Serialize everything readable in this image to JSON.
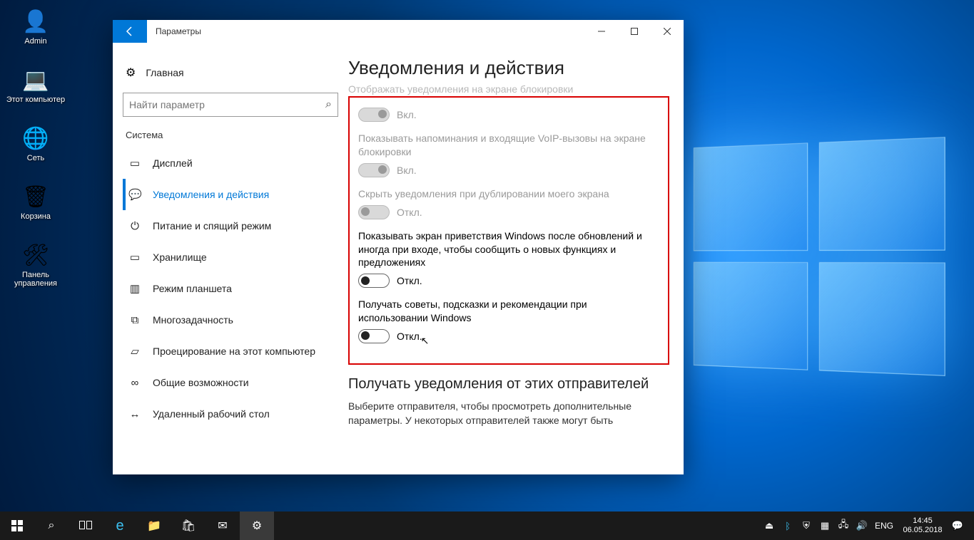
{
  "desktop": {
    "icons": [
      {
        "label": "Admin",
        "glyph": "👤"
      },
      {
        "label": "Этот компьютер",
        "glyph": "💻"
      },
      {
        "label": "Сеть",
        "glyph": "🌐"
      },
      {
        "label": "Корзина",
        "glyph": "🗑"
      },
      {
        "label": "Панель управления",
        "glyph": "🛠"
      }
    ]
  },
  "window": {
    "title": "Параметры",
    "home": "Главная",
    "search_placeholder": "Найти параметр",
    "group": "Система",
    "nav": [
      {
        "label": "Дисплей"
      },
      {
        "label": "Уведомления и действия"
      },
      {
        "label": "Питание и спящий режим"
      },
      {
        "label": "Хранилище"
      },
      {
        "label": "Режим планшета"
      },
      {
        "label": "Многозадачность"
      },
      {
        "label": "Проецирование на этот компьютер"
      },
      {
        "label": "Общие возможности"
      },
      {
        "label": "Удаленный рабочий стол"
      }
    ],
    "page_title": "Уведомления и действия",
    "cutoff": "Отображать уведомления на экране блокировки",
    "opts": [
      {
        "label": "",
        "state": "Вкл.",
        "on": true,
        "disabled": true
      },
      {
        "label": "Показывать напоминания и входящие VoIP-вызовы на экране блокировки",
        "state": "Вкл.",
        "on": true,
        "disabled": true
      },
      {
        "label": "Скрыть уведомления при дублировании моего экрана",
        "state": "Откл.",
        "on": false,
        "disabled": true
      },
      {
        "label": "Показывать экран приветствия Windows после обновлений и иногда при входе, чтобы сообщить о новых функциях и предложениях",
        "state": "Откл.",
        "on": false,
        "disabled": false
      },
      {
        "label": "Получать советы, подсказки и рекомендации при использовании Windows",
        "state": "Откл.",
        "on": false,
        "disabled": false
      }
    ],
    "section2_title": "Получать уведомления от этих отправителей",
    "section2_body": "Выберите отправителя, чтобы просмотреть дополнительные параметры. У некоторых отправителей также могут быть"
  },
  "taskbar": {
    "lang": "ENG",
    "time": "14:45",
    "date": "06.05.2018"
  }
}
